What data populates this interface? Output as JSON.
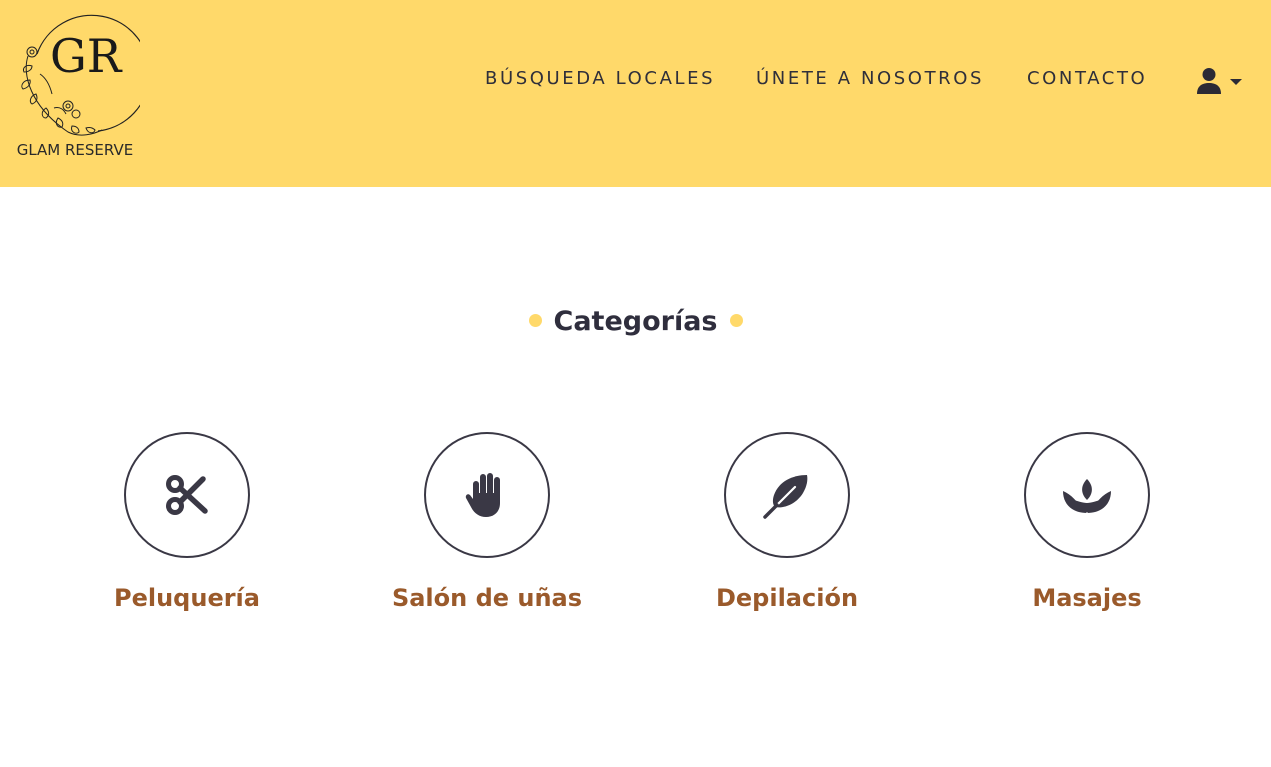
{
  "brand": {
    "monogram": "GR",
    "name": "GLAM RESERVE"
  },
  "nav": {
    "items": [
      {
        "label": "BÚSQUEDA LOCALES"
      },
      {
        "label": "ÚNETE A NOSOTROS"
      },
      {
        "label": "CONTACTO"
      }
    ],
    "user_icon": "user-icon",
    "caret_icon": "caret-down-icon"
  },
  "categories": {
    "title": "Categorías",
    "items": [
      {
        "label": "Peluquería",
        "icon": "scissors-icon"
      },
      {
        "label": "Salón de uñas",
        "icon": "hand-icon"
      },
      {
        "label": "Depilación",
        "icon": "feather-icon"
      },
      {
        "label": "Masajes",
        "icon": "lotus-icon"
      }
    ]
  },
  "colors": {
    "header_bg": "#FFD96A",
    "accent_dot": "#FFD96A",
    "text_dark": "#2f2e3d",
    "category_label": "#9A5A2B"
  }
}
